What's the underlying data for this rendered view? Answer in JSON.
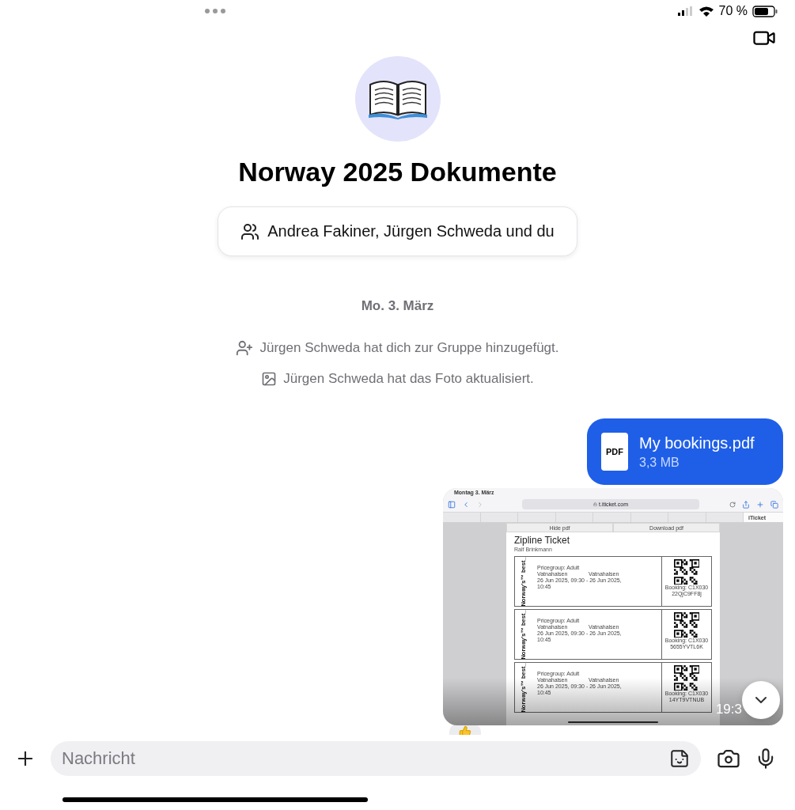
{
  "status_bar": {
    "battery": "70 %"
  },
  "group": {
    "title": "Norway 2025 Dokumente",
    "members": "Andrea Fakiner, Jürgen Schweda und du"
  },
  "date": "Mo. 3. März",
  "events": [
    {
      "kind": "added",
      "text": "Jürgen Schweda hat dich zur Gruppe hinzugefügt."
    },
    {
      "kind": "photo",
      "text": "Jürgen Schweda hat das Foto aktualisiert."
    }
  ],
  "file_message": {
    "badge": "PDF",
    "name": "My bookings.pdf",
    "size": "3,3 MB"
  },
  "image_message": {
    "time": "19:3",
    "screenshot": {
      "date": "Montag 3. März",
      "url": "t.iticket.com",
      "active_tab": "iTicket",
      "buttons": [
        "Hide pdf",
        "Download pdf"
      ],
      "doc_title": "Zipline Ticket",
      "doc_subtitle": "Ralf Brinkmann",
      "tickets": [
        {
          "brand": "Norway's™ best_",
          "pricegroup": "Pricegroup: Adult",
          "from": "Vatnahalsen",
          "to": "Vatnahalsen",
          "time": "26 Jun 2025, 09:30 - 26 Jun 2025, 10:45",
          "booking": "Booking: C1X030",
          "code": "22QjC9FF8j"
        },
        {
          "brand": "Norway's™ best_",
          "pricegroup": "Pricegroup: Adult",
          "from": "Vatnahalsen",
          "to": "Vatnahalsen",
          "time": "26 Jun 2025, 09:30 - 26 Jun 2025, 10:45",
          "booking": "Booking: C1X030",
          "code": "5655YVTL6K"
        },
        {
          "brand": "Norway's™ best_",
          "pricegroup": "Pricegroup: Adult",
          "from": "Vatnahalsen",
          "to": "Vatnahalsen",
          "time": "26 Jun 2025, 09:30 - 26 Jun 2025, 10:45",
          "booking": "Booking: C1X030",
          "code": "14YT9VTNUB"
        }
      ]
    }
  },
  "composer": {
    "placeholder": "Nachricht"
  }
}
